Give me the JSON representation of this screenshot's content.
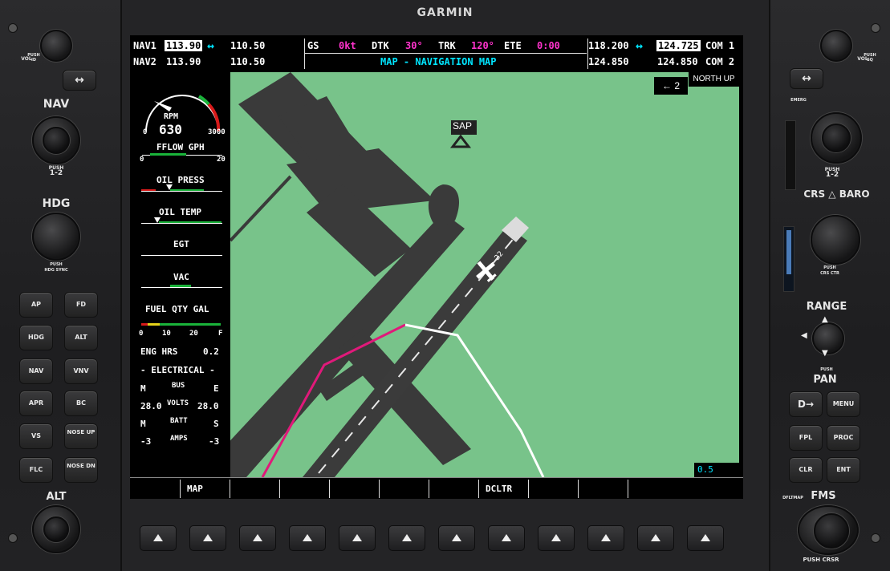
{
  "brand": "GARMIN",
  "left_controls": {
    "vol_label": "VOL",
    "vol_push": "PUSH ID",
    "swap_arrow": "↔",
    "nav_label": "NAV",
    "nav_push": "PUSH",
    "nav_push2": "1-2",
    "hdg_label": "HDG",
    "hdg_push": "PUSH",
    "hdg_push2": "HDG SYNC",
    "alt_label": "ALT",
    "buttons": [
      {
        "label": "AP"
      },
      {
        "label": "FD"
      },
      {
        "label": "HDG"
      },
      {
        "label": "ALT"
      },
      {
        "label": "NAV"
      },
      {
        "label": "VNV"
      },
      {
        "label": "APR"
      },
      {
        "label": "BC"
      },
      {
        "label": "VS"
      },
      {
        "label": "NOSE UP"
      },
      {
        "label": "FLC"
      },
      {
        "label": "NOSE DN"
      }
    ]
  },
  "right_controls": {
    "vol_label": "VOL",
    "vol_push": "PUSH SQ",
    "swap_arrow": "↔",
    "emerg": "EMERG",
    "push": "PUSH",
    "push2": "1-2",
    "crs_baro": "CRS",
    "baro": "BARO",
    "crs_push": "PUSH",
    "crs_push2": "CRS CTR",
    "range": "RANGE",
    "range_push": "PUSH",
    "pan": "PAN",
    "direct_to": "D→",
    "menu": "MENU",
    "fpl": "FPL",
    "proc": "PROC",
    "clr": "CLR",
    "ent": "ENT",
    "dfltmap": "DFLTMAP",
    "fms": "FMS",
    "fms_push": "PUSH CRSR"
  },
  "nav": {
    "nav1_label": "NAV1",
    "nav1_active": "113.90",
    "nav1_standby": "110.50",
    "nav2_label": "NAV2",
    "nav2_active": "113.90",
    "nav2_standby": "110.50",
    "swap": "↔"
  },
  "com": {
    "com1_standby": "118.200",
    "com1_active": "124.725",
    "com1_label": "COM 1",
    "com2_standby": "124.850",
    "com2_active": "124.850",
    "com2_label": "COM 2",
    "swap": "↔"
  },
  "status": {
    "gs_label": "GS",
    "gs_value": "0kt",
    "dtk_label": "DTK",
    "dtk_value": "30°",
    "trk_label": "TRK",
    "trk_value": "120°",
    "ete_label": "ETE",
    "ete_value": "0:00"
  },
  "page_title": "MAP - NAVIGATION MAP",
  "map": {
    "orientation": "NORTH UP",
    "wind": "← 2",
    "waypoint": "SAP",
    "runway_number": "22",
    "scale": "0.5",
    "colors": {
      "terrain": "#78c38a",
      "taxi": "#3b3b3b",
      "route_active": "#e0197a",
      "route": "#ffffff"
    }
  },
  "eis": {
    "rpm_label": "RPM",
    "rpm_value": "630",
    "rpm_min": "0",
    "rpm_max": "3000",
    "fflow_label": "FFLOW GPH",
    "fflow_min": "0",
    "fflow_max": "20",
    "oil_press": "OIL PRESS",
    "oil_temp": "OIL TEMP",
    "egt": "EGT",
    "vac": "VAC",
    "fuel_label": "FUEL QTY GAL",
    "fuel_ticks": [
      "0",
      "10",
      "20",
      "F"
    ],
    "eng_hrs_label": "ENG HRS",
    "eng_hrs_value": "0.2",
    "electrical": "- ELECTRICAL -",
    "bus_m": "M",
    "bus_label": "BUS",
    "bus_e": "E",
    "volts_m": "28.0",
    "volts_label": "VOLTS",
    "volts_e": "28.0",
    "batt_m": "M",
    "batt_label": "BATT",
    "batt_s": "S",
    "amps_m": "-3",
    "amps_label": "AMPS",
    "amps_s": "-3"
  },
  "softkeys": [
    "",
    "MAP",
    "",
    "",
    "",
    "",
    "",
    "DCLTR",
    "",
    "",
    ""
  ]
}
